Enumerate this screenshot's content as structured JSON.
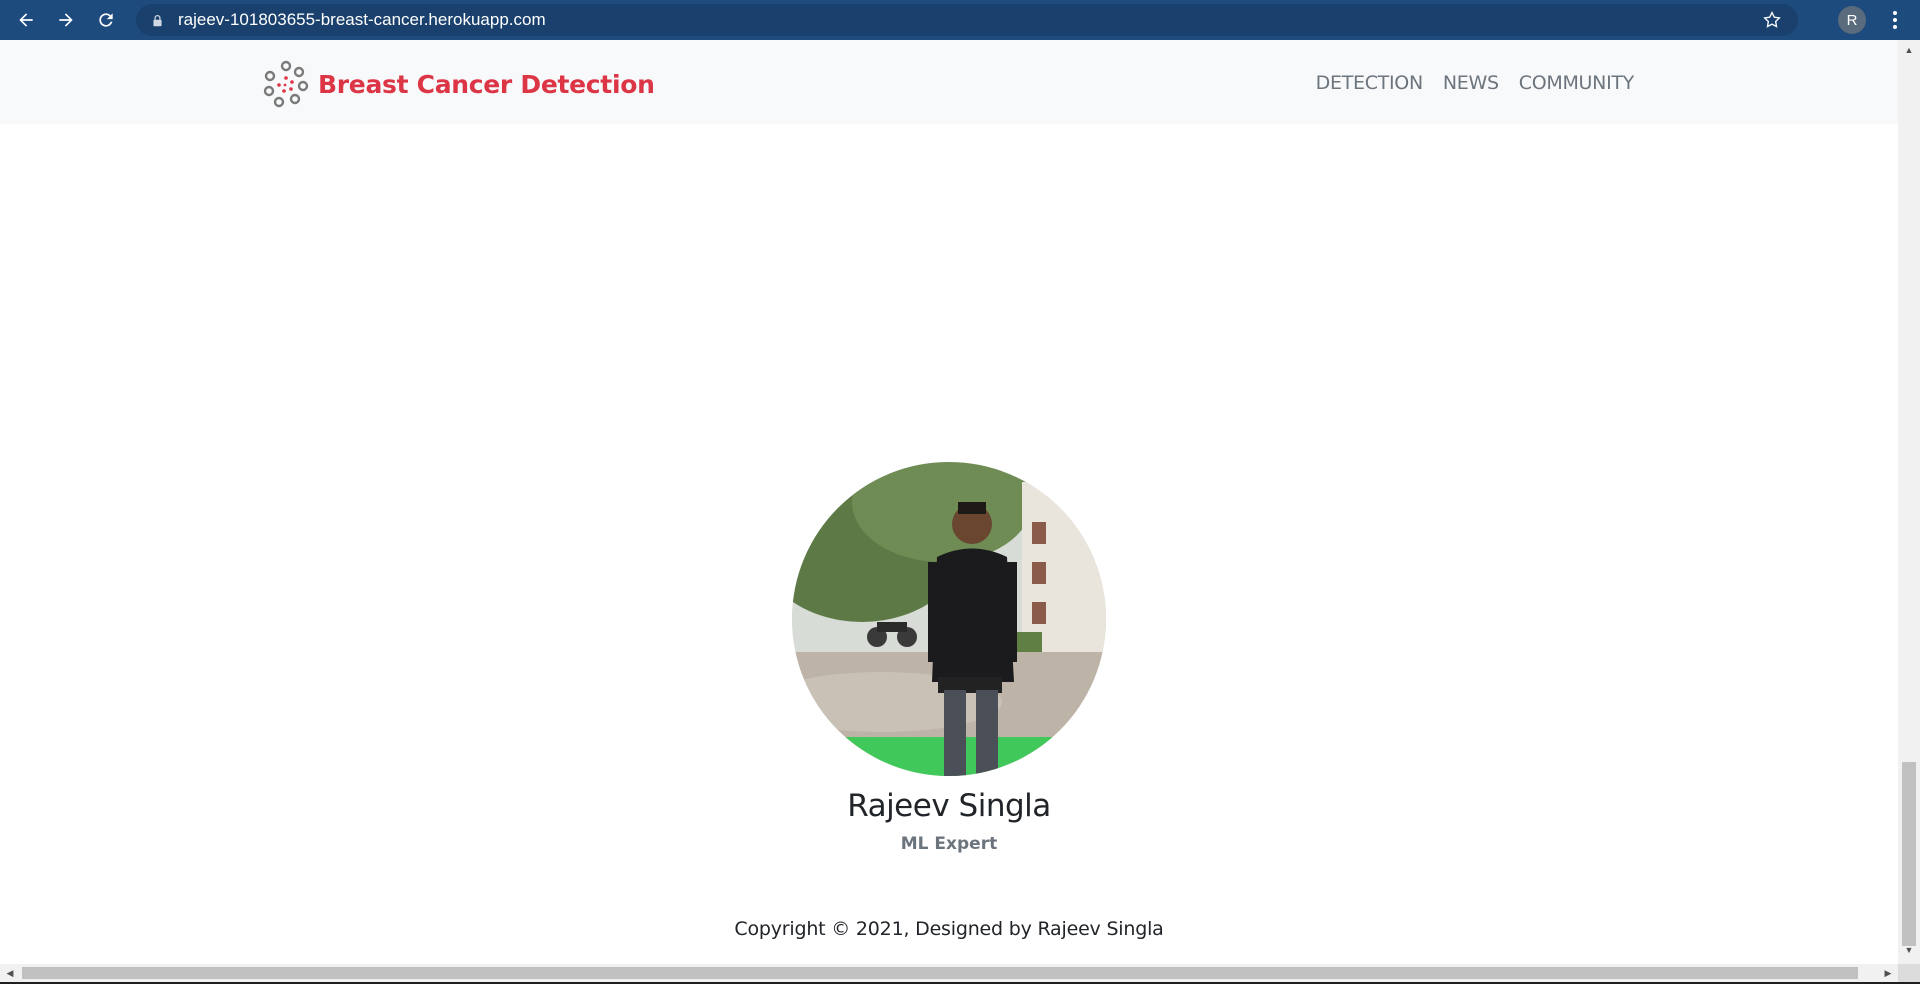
{
  "browser": {
    "url": "rajeev-101803655-breast-cancer.herokuapp.com",
    "profile_initial": "R",
    "icons": [
      "back-icon",
      "forward-icon",
      "reload-icon",
      "lock-icon",
      "star-icon",
      "menu-icon"
    ]
  },
  "site": {
    "brand": "Breast Cancer Detection",
    "brand_color": "#dc3545",
    "nav": [
      {
        "label": "DETECTION"
      },
      {
        "label": "NEWS"
      },
      {
        "label": "COMMUNITY"
      }
    ]
  },
  "member": {
    "name": "Rajeev Singla",
    "role": "ML Expert"
  },
  "footer": {
    "copyright": "Copyright © 2021, Designed by Rajeev Singla"
  }
}
